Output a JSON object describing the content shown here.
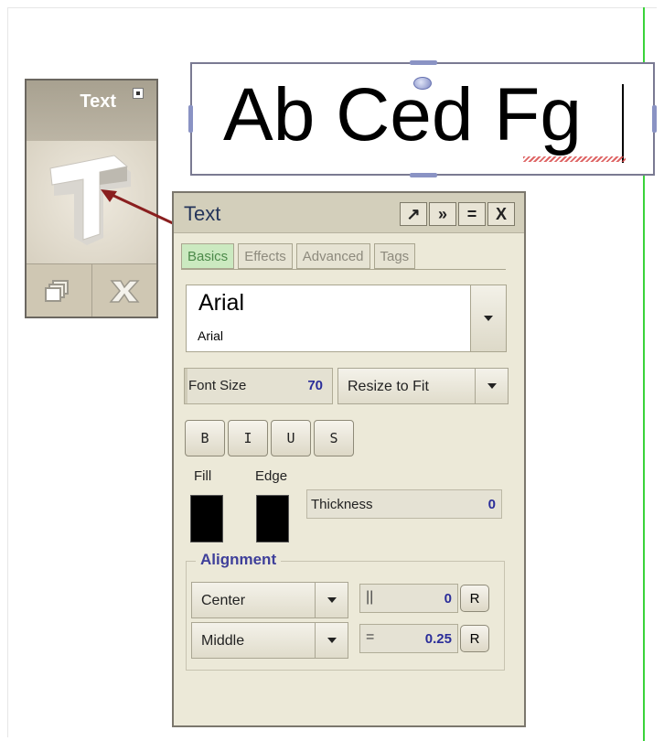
{
  "canvas": {
    "text_content": "Ab Ced Fg"
  },
  "tool_palette": {
    "title": "Text",
    "icons": [
      "text-tool-icon",
      "layers-icon",
      "delete-x-icon"
    ]
  },
  "panel": {
    "title": "Text",
    "title_buttons": [
      {
        "name": "pin-button",
        "glyph": "↗"
      },
      {
        "name": "expand-button",
        "glyph": "»"
      },
      {
        "name": "menu-button",
        "glyph": "="
      },
      {
        "name": "close-button",
        "glyph": "X"
      }
    ],
    "tabs": [
      {
        "label": "Basics",
        "active": true
      },
      {
        "label": "Effects",
        "active": false
      },
      {
        "label": "Advanced",
        "active": false
      },
      {
        "label": "Tags",
        "active": false
      }
    ],
    "font": {
      "name": "Arial",
      "preview": "Arial"
    },
    "font_size": {
      "label": "Font Size",
      "value": "70"
    },
    "resize_mode": "Resize to Fit",
    "style_buttons": [
      "B",
      "I",
      "U",
      "S"
    ],
    "fill_label": "Fill",
    "edge_label": "Edge",
    "fill_color": "#000000",
    "edge_color": "#000000",
    "thickness": {
      "label": "Thickness",
      "value": "0"
    },
    "alignment": {
      "title": "Alignment",
      "horizontal": "Center",
      "vertical": "Middle",
      "horizontal_offset": "0",
      "vertical_offset": "0.25",
      "reset_label": "R"
    }
  }
}
